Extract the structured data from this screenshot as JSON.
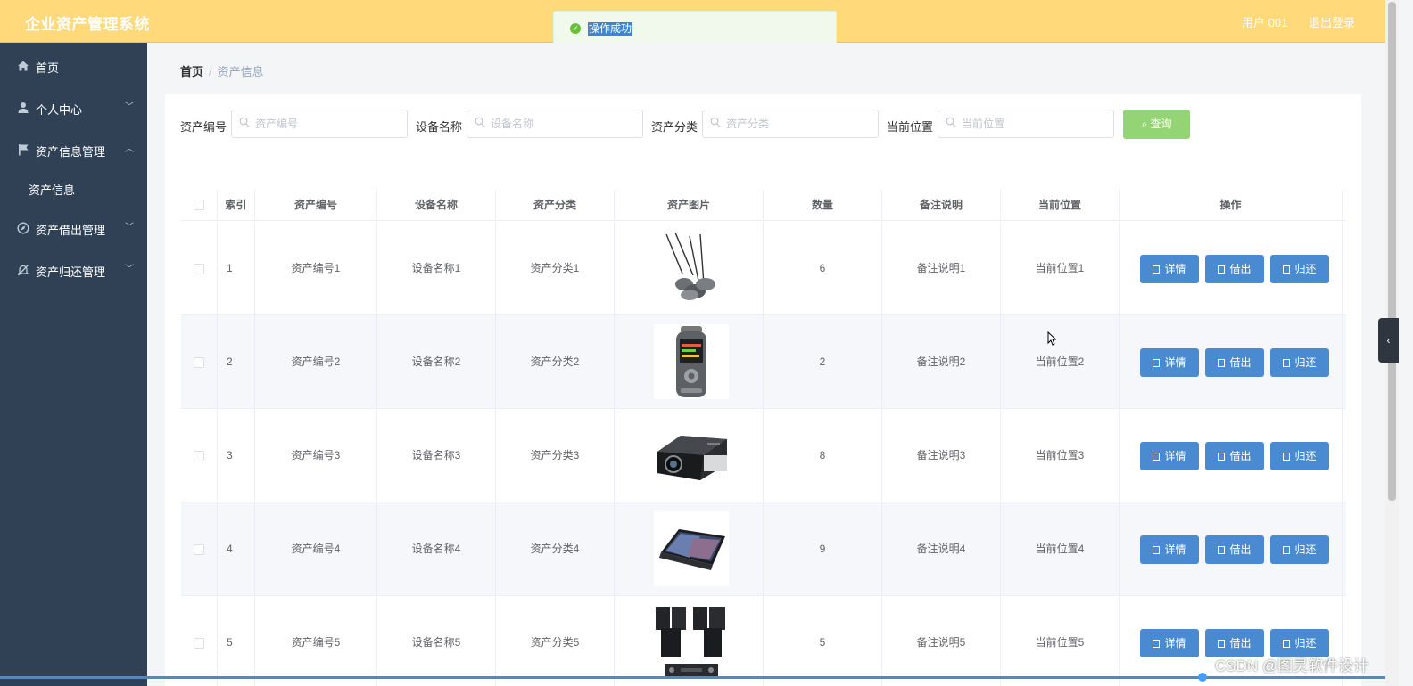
{
  "app": {
    "title": "企业资产管理系统",
    "user": "用户 001",
    "logout": "退出登录"
  },
  "toast": {
    "message": "操作成功"
  },
  "sidebar": {
    "items": [
      {
        "label": "首页",
        "icon": "home-icon"
      },
      {
        "label": "个人中心",
        "icon": "user-icon"
      },
      {
        "label": "资产信息管理",
        "icon": "flag-icon"
      },
      {
        "label": "资产借出管理",
        "icon": "compass-icon"
      },
      {
        "label": "资产归还管理",
        "icon": "bell-off-icon"
      }
    ],
    "subitem": "资产信息"
  },
  "breadcrumb": {
    "home": "首页",
    "separator": "/",
    "current": "资产信息"
  },
  "search": {
    "fields": [
      {
        "label": "资产编号",
        "placeholder": "资产编号"
      },
      {
        "label": "设备名称",
        "placeholder": "设备名称"
      },
      {
        "label": "资产分类",
        "placeholder": "资产分类"
      },
      {
        "label": "当前位置",
        "placeholder": "当前位置"
      }
    ],
    "button": "查询"
  },
  "table": {
    "columns": [
      "索引",
      "资产编号",
      "设备名称",
      "资产分类",
      "资产图片",
      "数量",
      "备注说明",
      "当前位置",
      "操作"
    ],
    "actions": {
      "detail": "详情",
      "borrow": "借出",
      "return": "归还"
    },
    "rows": [
      {
        "index": "1",
        "code": "资产编号1",
        "name": "设备名称1",
        "category": "资产分类1",
        "image": "conference-microphones",
        "qty": "6",
        "note": "备注说明1",
        "location": "当前位置1"
      },
      {
        "index": "2",
        "code": "资产编号2",
        "name": "设备名称2",
        "category": "资产分类2",
        "image": "voice-recorder",
        "qty": "2",
        "note": "备注说明2",
        "location": "当前位置2"
      },
      {
        "index": "3",
        "code": "资产编号3",
        "name": "设备名称3",
        "category": "资产分类3",
        "image": "projector",
        "qty": "8",
        "note": "备注说明3",
        "location": "当前位置3"
      },
      {
        "index": "4",
        "code": "资产编号4",
        "name": "设备名称4",
        "category": "资产分类4",
        "image": "touch-screen-terminal",
        "qty": "9",
        "note": "备注说明4",
        "location": "当前位置4"
      },
      {
        "index": "5",
        "code": "资产编号5",
        "name": "设备名称5",
        "category": "资产分类5",
        "image": "speakers-amplifier",
        "qty": "5",
        "note": "备注说明5",
        "location": "当前位置5"
      }
    ]
  },
  "watermark": "CSDN @图灵软件设计",
  "colors": {
    "header": "#ffd97a",
    "sidebar": "#304156",
    "action_button": "#4a8ad0",
    "query_button": "#95d475",
    "toast_bg": "#f0f9eb"
  }
}
